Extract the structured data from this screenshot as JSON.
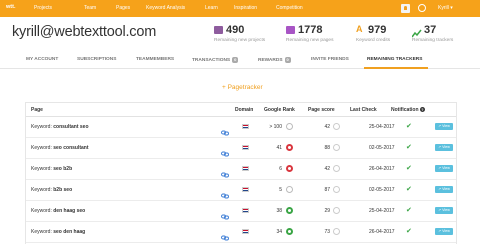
{
  "topnav": {
    "logo": "wtt.",
    "items": [
      "Projects",
      "Team",
      "Pages",
      "Keyword Analysis",
      "Learn",
      "Inspiration",
      "Competition"
    ],
    "user": "Kyrill"
  },
  "header": {
    "email": "kyrill@webtexttool.com",
    "stats": [
      {
        "value": "490",
        "label": "Remaining new projects",
        "color": "#8e5c9e"
      },
      {
        "value": "1778",
        "label": "Remaining new pages",
        "color": "#a855c5"
      },
      {
        "value": "979",
        "label": "Keyword credits",
        "color": "#f0a020"
      },
      {
        "value": "37",
        "label": "Remaining trackers",
        "color": "#3aa545"
      }
    ]
  },
  "tabs": [
    {
      "label": "MY ACCOUNT",
      "badge": ""
    },
    {
      "label": "SUBSCRIPTIONS",
      "badge": ""
    },
    {
      "label": "TEAMMEMBERS",
      "badge": ""
    },
    {
      "label": "TRANSACTIONS",
      "badge": "0"
    },
    {
      "label": "REWARDS",
      "badge": "0"
    },
    {
      "label": "INVITE FRIENDS",
      "badge": ""
    },
    {
      "label": "REMAINING TRACKERS",
      "badge": "",
      "active": true
    }
  ],
  "pagetracker_link": "+ Pagetracker",
  "table": {
    "headers": [
      "Page",
      "Domain",
      "Google Rank",
      "Page score",
      "Last Check",
      "Notification"
    ],
    "view_label": "View",
    "keyword_prefix": "Keyword:",
    "rows": [
      {
        "keyword": "consultant seo",
        "rank": "> 100",
        "rank_trend": "neutral",
        "score": "42",
        "date": "25-04-2017"
      },
      {
        "keyword": "seo consultant",
        "rank": "41",
        "rank_trend": "down",
        "score": "88",
        "date": "02-05-2017"
      },
      {
        "keyword": "seo b2b",
        "rank": "6",
        "rank_trend": "down",
        "score": "42",
        "date": "26-04-2017"
      },
      {
        "keyword": "b2b seo",
        "rank": "5",
        "rank_trend": "neutral",
        "score": "87",
        "date": "02-05-2017"
      },
      {
        "keyword": "den haag seo",
        "rank": "38",
        "rank_trend": "up",
        "score": "29",
        "date": "25-04-2017"
      },
      {
        "keyword": "seo den haag",
        "rank": "34",
        "rank_trend": "up",
        "score": "73",
        "date": "26-04-2017"
      }
    ]
  }
}
